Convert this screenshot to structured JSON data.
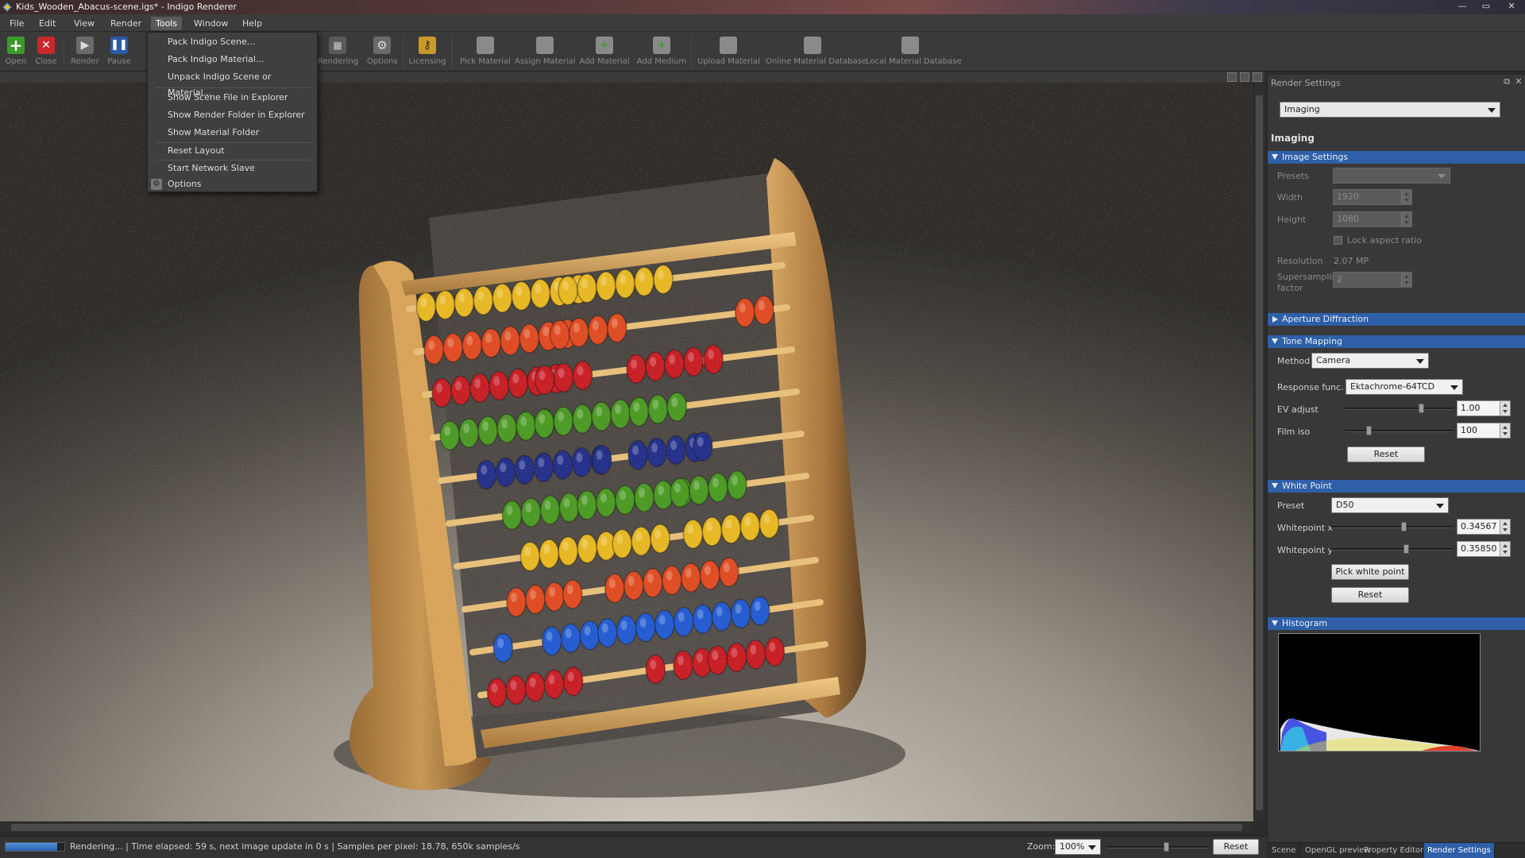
{
  "window": {
    "title": "Kids_Wooden_Abacus-scene.igs* - Indigo Renderer",
    "minimize": "—",
    "maximize": "▭",
    "close": "✕"
  },
  "menubar": {
    "items": [
      "File",
      "Edit",
      "View",
      "Render",
      "Tools",
      "Window",
      "Help"
    ],
    "active": "Tools"
  },
  "toolbar": {
    "buttons": [
      {
        "label": "Open",
        "icon": "plus-icon"
      },
      {
        "label": "Close",
        "icon": "close-icon"
      },
      {
        "label": "Render",
        "icon": "play-icon"
      },
      {
        "label": "Pause",
        "icon": "pause-icon"
      },
      {
        "label": "Rendering",
        "icon": "render-settings-icon"
      },
      {
        "label": "Options",
        "icon": "gear-icon"
      },
      {
        "label": "Licensing",
        "icon": "key-icon"
      },
      {
        "label": "Pick Material",
        "icon": "pick-material-icon"
      },
      {
        "label": "Assign Material",
        "icon": "assign-material-icon"
      },
      {
        "label": "Add Material",
        "icon": "add-material-icon"
      },
      {
        "label": "Add Medium",
        "icon": "add-medium-icon"
      },
      {
        "label": "Upload Material",
        "icon": "upload-material-icon"
      },
      {
        "label": "Online Material Database",
        "icon": "online-database-icon"
      },
      {
        "label": "Local Material Database",
        "icon": "local-database-icon"
      }
    ]
  },
  "tools_menu": {
    "items": [
      "Pack Indigo Scene...",
      "Pack Indigo Material...",
      "Unpack Indigo Scene or Material...",
      "Show Scene File in Explorer",
      "Show Render Folder in Explorer",
      "Show Material Folder",
      "Reset Layout",
      "Start Network Slave",
      "Options"
    ]
  },
  "render_settings": {
    "panel_title": "Render Settings",
    "category_select": "Imaging",
    "heading": "Imaging",
    "image_settings": {
      "title": "Image Settings",
      "presets_label": "Presets",
      "presets_value": "",
      "width_label": "Width",
      "width_value": "1920",
      "height_label": "Height",
      "height_value": "1080",
      "lock_aspect_label": "Lock aspect ratio",
      "resolution_label": "Resolution",
      "resolution_value": "2.07 MP",
      "supersampling_label_1": "Supersampling",
      "supersampling_label_2": "factor",
      "supersampling_value": "2"
    },
    "aperture_diffraction": {
      "title": "Aperture Diffraction"
    },
    "tone_mapping": {
      "title": "Tone Mapping",
      "method_label": "Method",
      "method_value": "Camera",
      "response_label": "Response func.",
      "response_value": "Ektachrome-64TCD",
      "ev_label": "EV adjust",
      "ev_value": "1.00",
      "ev_slider": 0.72,
      "iso_label": "Film iso",
      "iso_value": "100",
      "iso_slider": 0.2,
      "reset_label": "Reset"
    },
    "white_point": {
      "title": "White Point",
      "preset_label": "Preset",
      "preset_value": "D50",
      "wx_label": "Whitepoint x",
      "wx_value": "0.34567",
      "wx_slider": 0.6,
      "wy_label": "Whitepoint y",
      "wy_value": "0.35850",
      "wy_slider": 0.62,
      "pick_label": "Pick white point",
      "reset_label": "Reset"
    },
    "histogram": {
      "title": "Histogram"
    }
  },
  "statusbar": {
    "progress": 0.88,
    "text": "Rendering... | Time elapsed: 59 s, next image update in 0 s | Samples per pixel: 18.78, 650k samples/s",
    "zoom_label": "Zoom:",
    "zoom_value": "100%",
    "zoom_slider": 0.6,
    "reset_label": "Reset"
  },
  "bottom_tabs": {
    "items": [
      "Scene",
      "OpenGL preview",
      "Property Editor",
      "Render Settings"
    ],
    "active": "Render Settings"
  },
  "colors": {
    "accent": "#2e5fa8",
    "wood": "#c8934a",
    "bead_rows": [
      "#e8b81a",
      "#e04a1a",
      "#c8141e",
      "#4a9a1e",
      "#1e2c8a",
      "#4a9a1e",
      "#e8b81a",
      "#e04a1a",
      "#1e5ad2",
      "#c8141e"
    ]
  }
}
